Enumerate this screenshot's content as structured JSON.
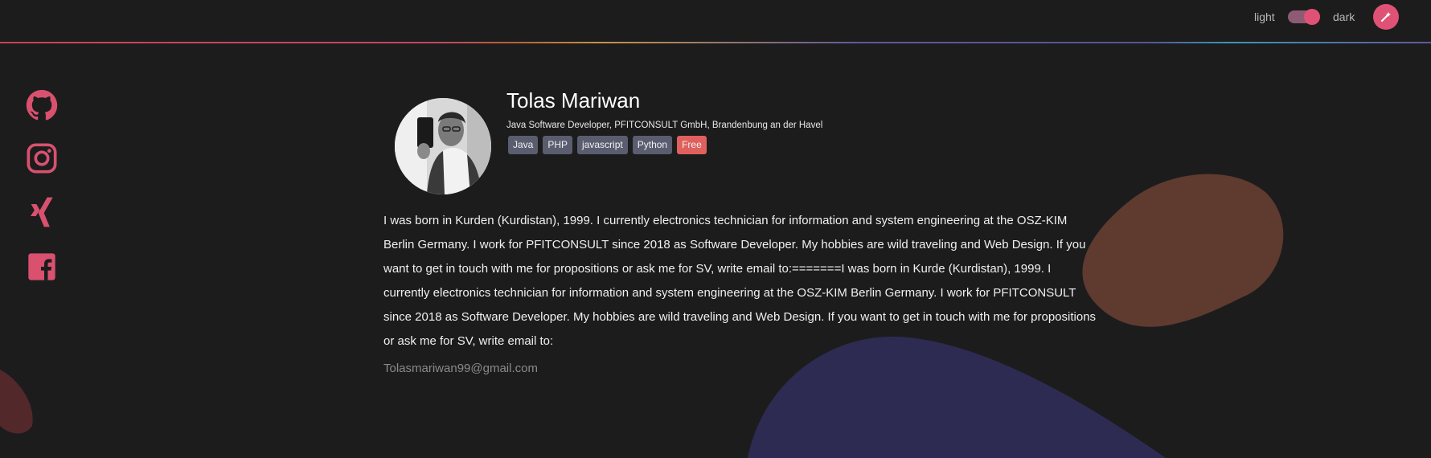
{
  "header": {
    "theme_light_label": "light",
    "theme_dark_label": "dark",
    "theme_toggle_state": "dark",
    "accent_color": "#e05275"
  },
  "social_links": [
    {
      "icon": "github-icon"
    },
    {
      "icon": "instagram-icon"
    },
    {
      "icon": "xing-icon"
    },
    {
      "icon": "facebook-icon"
    }
  ],
  "profile": {
    "name": "Tolas Mariwan",
    "subtitle": "Java Software Developer, PFITCONSULT GmbH, Brandenbung an der Havel",
    "tags": [
      "Java",
      "PHP",
      "javascript",
      "Python",
      "Free"
    ],
    "bio": "I was born in Kurden (Kurdistan), 1999. I currently electronics technician for information and system engineering at the OSZ-KIM Berlin Germany. I work for PFITCONSULT since 2018 as Software Developer. My hobbies are wild traveling and Web Design. If you want to get in touch with me for propositions or ask me for SV, write email to:=======I was born in Kurde (Kurdistan), 1999. I currently electronics technician for information and system engineering at the OSZ-KIM Berlin Germany. I work for PFITCONSULT since 2018 as Software Developer. My hobbies are wild traveling and Web Design. If you want to get in touch with me for propositions or ask me for SV, write email to:",
    "email": "Tolasmariwan99@gmail.com"
  }
}
